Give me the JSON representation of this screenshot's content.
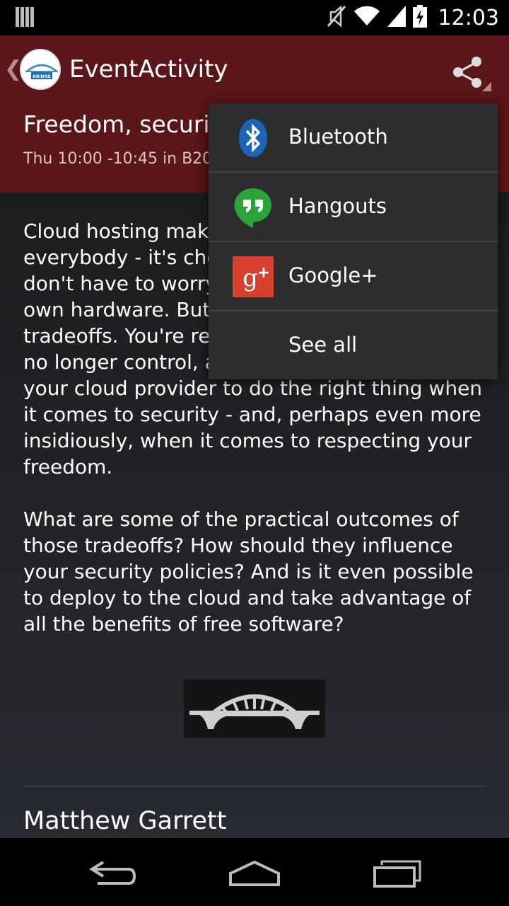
{
  "status_bar": {
    "time": "12:03",
    "icons": [
      "notification-icon",
      "mute-icon",
      "wifi-icon",
      "signal-icon",
      "battery-charging-icon"
    ]
  },
  "action_bar": {
    "title": "EventActivity",
    "logo_text": "OPEN SOURCE BRIDGE",
    "share_icon": "share-icon"
  },
  "event": {
    "title": "Freedom, security, and the cloud",
    "meta": "Thu 10:00 -10:45 in B204"
  },
  "description": {
    "paragraph1_lines": [
      "Cloud hosting makes life easier for",
      "everybody - it's cheaper, and you",
      "don't have to worry about your",
      "own hardware. But, there are",
      "tradeoffs. You're relying on what you",
      "no longer control, and trusting",
      "your cloud provider to do the right thing when",
      "it comes to security - and, perhaps even more",
      "insidiously, when it comes to respecting your",
      "freedom."
    ],
    "paragraph2_lines": [
      "What are some of the practical outcomes of",
      "those tradeoffs? How should they influence",
      "your security policies? And is it even possible",
      "to deploy to the cloud and take advantage of",
      "all the benefits of free software?"
    ]
  },
  "speaker": "Matthew Garrett",
  "share_menu": {
    "items": [
      {
        "label": "Bluetooth",
        "icon": "bluetooth-icon",
        "color": "#1b64b7"
      },
      {
        "label": "Hangouts",
        "icon": "hangouts-icon",
        "color": "#2aa43a"
      },
      {
        "label": "Google+",
        "icon": "google-plus-icon",
        "color": "#d7402f"
      },
      {
        "label": "See all",
        "icon": ""
      }
    ]
  },
  "nav_bar": [
    "back-icon",
    "home-icon",
    "recents-icon"
  ]
}
